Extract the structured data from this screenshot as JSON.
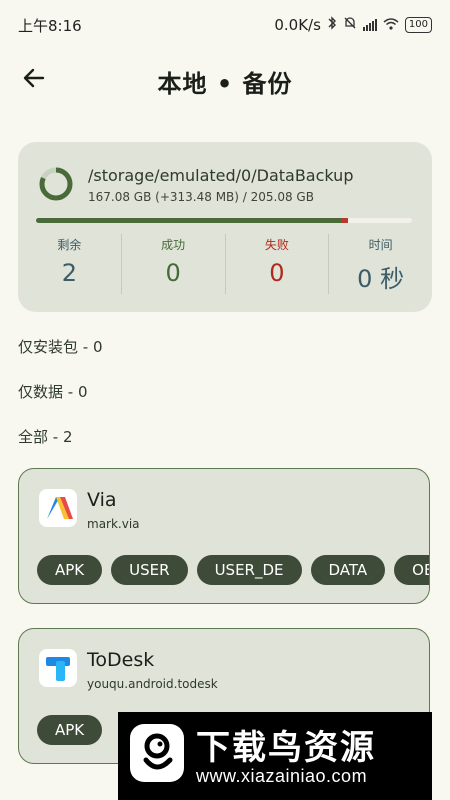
{
  "status_bar": {
    "time": "上午8:16",
    "net_speed": "0.0K/s",
    "battery": "100"
  },
  "app_bar": {
    "back_icon": "arrow-left-icon",
    "title": "本地 • 备份"
  },
  "summary": {
    "path": "/storage/emulated/0/DataBackup",
    "usage": "167.08 GB (+313.48 MB) / 205.08 GB",
    "used_fraction": 0.815,
    "pending_fraction": 0.015,
    "stats": [
      {
        "label": "剩余",
        "value": "2",
        "color": "#3c5c66"
      },
      {
        "label": "成功",
        "value": "0",
        "color": "#456b3a"
      },
      {
        "label": "失败",
        "value": "0",
        "color": "#b0291d"
      },
      {
        "label": "时间",
        "value": "0 秒",
        "color": "#3c5c66"
      }
    ]
  },
  "sections": {
    "apk_only": "仅安装包 - 0",
    "data_only": "仅数据 - 0",
    "all": "全部 - 2"
  },
  "apps": [
    {
      "name": "Via",
      "package": "mark.via",
      "icon": "via-icon",
      "chips": [
        "APK",
        "USER",
        "USER_DE",
        "DATA",
        "OBB"
      ]
    },
    {
      "name": "ToDesk",
      "package": "youqu.android.todesk",
      "icon": "todesk-icon",
      "chips": [
        "APK"
      ]
    }
  ],
  "watermark": {
    "title": "下载鸟资源",
    "url": "www.xiazainiao.com"
  },
  "colors": {
    "background": "#f8f8f0",
    "card": "#dfe3d8",
    "accent": "#4a6a3a",
    "error": "#b83a2a",
    "chip": "#3e4b38"
  }
}
